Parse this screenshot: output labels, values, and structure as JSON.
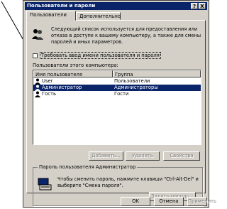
{
  "window": {
    "title": "Пользователи и пароли",
    "help_glyph": "?",
    "close_glyph": "X"
  },
  "tabs": [
    "Пользователи",
    "Дополнительно"
  ],
  "info_text": "Следующий список используется для предоставления или отказа в доступе к вашему компьютеру, а также для смены паролей и иных параметров.",
  "checkbox_label": "Требовать ввод имени пользователя и пароля",
  "users_section_label": "Пользователи этого компьютера:",
  "users_table": {
    "columns": [
      "Имя пользователя",
      "Группа"
    ],
    "rows": [
      {
        "name": "User",
        "group": "Пользователи",
        "selected": false
      },
      {
        "name": "Администратор",
        "group": "Администраторы",
        "selected": true
      },
      {
        "name": "Гость",
        "group": "Гости",
        "selected": false
      }
    ]
  },
  "user_buttons": {
    "add": "Добавить...",
    "delete": "Удалить",
    "properties": "Свойства"
  },
  "password_group": {
    "title": "Пароль пользователя Администратор",
    "text": "Чтобы сменить пароль, нажмите клавиши \"Ctrl-Alt-Del\" и выберите \"Смена пароля\".",
    "set_password_button": "Задать пароль..."
  },
  "dialog_buttons": {
    "ok": "OK",
    "cancel": "Отмена",
    "apply": "Применить"
  },
  "colors": {
    "title_bar": "#0a246a",
    "selection": "#0a246a",
    "face": "#d4d0c8"
  }
}
